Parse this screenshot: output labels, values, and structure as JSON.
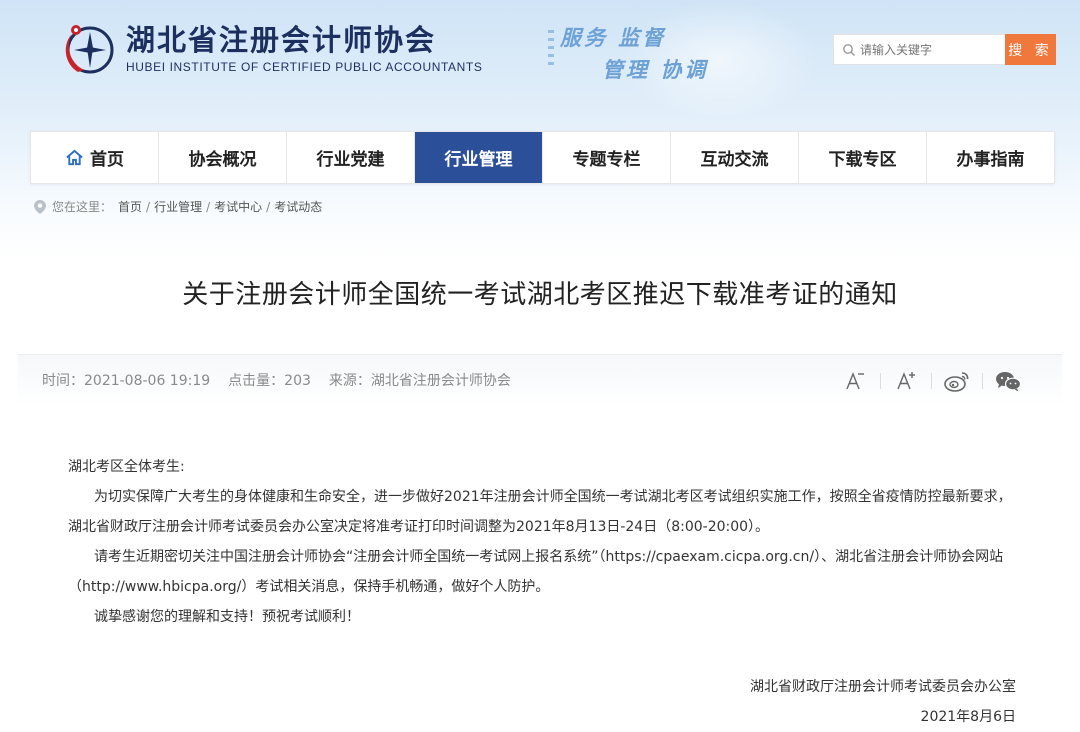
{
  "site": {
    "name_cn": "湖北省注册会计师协会",
    "name_en": "HUBEI INSTITUTE OF CERTIFIED PUBLIC ACCOUNTANTS",
    "slogan_line1": "服务 监督",
    "slogan_line2": "管理 协调"
  },
  "search": {
    "placeholder": "请输入关键字",
    "button_label": "搜 索"
  },
  "nav": {
    "items": [
      {
        "label": "首页"
      },
      {
        "label": "协会概况"
      },
      {
        "label": "行业党建"
      },
      {
        "label": "行业管理"
      },
      {
        "label": "专题专栏"
      },
      {
        "label": "互动交流"
      },
      {
        "label": "下载专区"
      },
      {
        "label": "办事指南"
      }
    ],
    "active_index": 3,
    "active_color": "#2c4f9a"
  },
  "breadcrumb": {
    "label": "您在这里：",
    "items": [
      "首页",
      "行业管理",
      "考试中心",
      "考试动态"
    ],
    "separator": "/"
  },
  "article": {
    "title": "关于注册会计师全国统一考试湖北考区推迟下载准考证的通知",
    "time": "时间：2021-08-06 19:19",
    "views": "点击量：203",
    "source": "来源：湖北省注册会计师协会",
    "greeting": "湖北考区全体考生:",
    "para1": "为切实保障广大考生的身体健康和生命安全，进一步做好2021年注册会计师全国统一考试湖北考区考试组织实施工作，按照全省疫情防控最新要求，湖北省财政厅注册会计师考试委员会办公室决定将准考证打印时间调整为2021年8月13日-24日（8:00-20:00）。",
    "para2": "请考生近期密切关注中国注册会计师协会“注册会计师全国统一考试网上报名系统”（https://cpaexam.cicpa.org.cn/）、湖北省注册会计师协会网站（http://www.hbicpa.org/）考试相关消息，保持手机畅通，做好个人防护。",
    "para3": "诚挚感谢您的理解和支持！预祝考试顺利！",
    "signature": "湖北省财政厅注册会计师考试委员会办公室",
    "date": "2021年8月6日"
  },
  "tools": {
    "icons": [
      "font-decrease-icon",
      "font-increase-icon",
      "weibo-icon",
      "wechat-icon"
    ]
  },
  "colors": {
    "brand": "#1c2f5e",
    "search_button": "#f0783c",
    "slogan": "#6ea2d6"
  }
}
